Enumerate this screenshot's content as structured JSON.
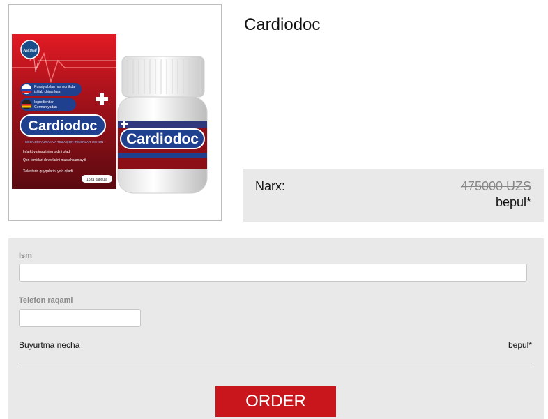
{
  "product": {
    "title": "Cardiodoc",
    "image": {
      "brand": "Cardiodoc",
      "box_line1": "Rossiya bilan hamkorlikda",
      "box_line2": "ishlab chiqarilgan",
      "box_line3": "Ingredientlar",
      "box_line4": "Germaniyadan",
      "tagline": "SOG'LOM YURAK VA TOZA QON TOMIRLAR UCHUN",
      "benefit1": "Infarkt va insultning oldini oladi",
      "benefit2": "Qon tomirlari devorlarini mustahkamlaydi",
      "benefit3": "Xolesterin quyqalarini yo'q qiladi",
      "capsules": "15 ta kapsula",
      "logo": "Natural"
    }
  },
  "price": {
    "label": "Narx:",
    "old": "475000 UZS",
    "new": "bepul*"
  },
  "form": {
    "name_label": "Ism",
    "name_value": "",
    "phone_label": "Telefon raqami",
    "phone_value": "",
    "quantity_label": "Buyurtma necha",
    "quantity_price": "bepul*",
    "order_label": "ORDER"
  },
  "colors": {
    "accent": "#c8161c",
    "panel": "#e9e9e9",
    "box_dark": "#7a0f18",
    "label_blue": "#1f3f8f"
  }
}
